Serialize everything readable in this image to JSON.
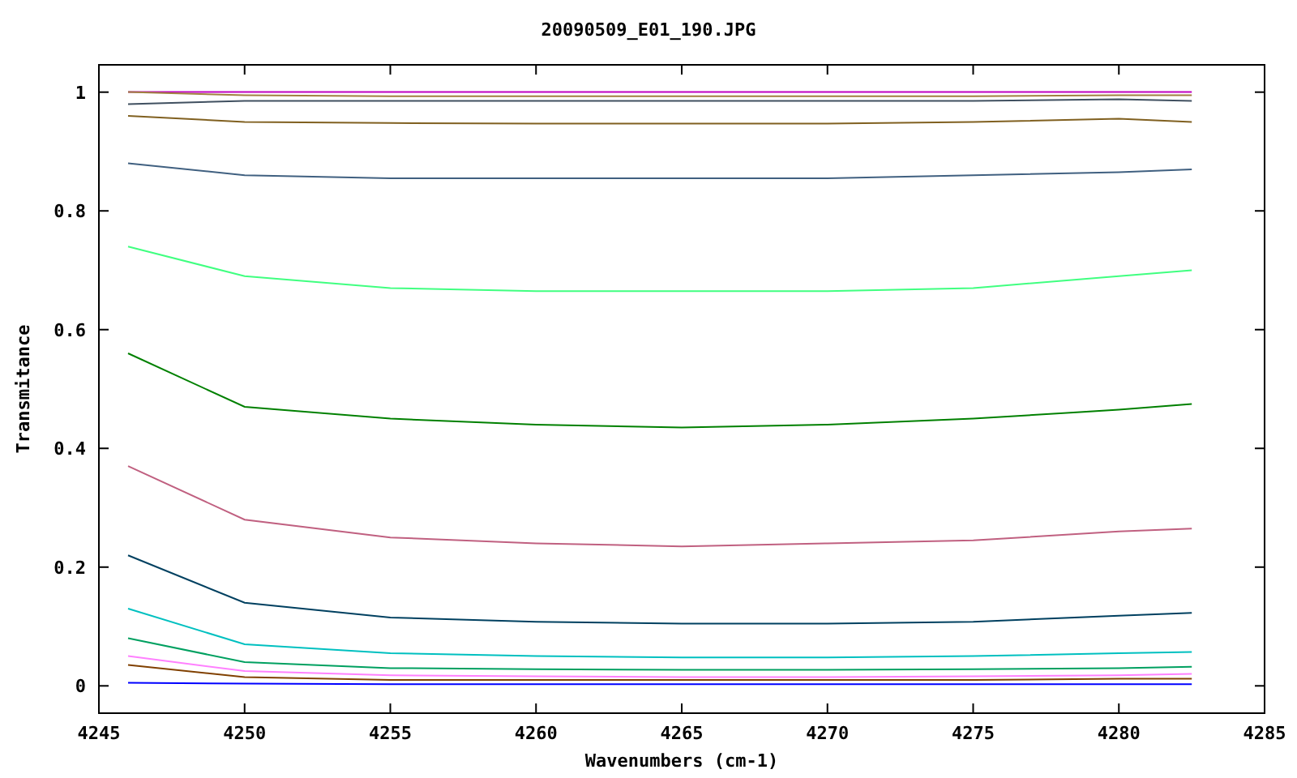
{
  "chart": {
    "chart_data": {
      "type": "line",
      "title": "20090509_E01_190.JPG",
      "xlabel": "Wavenumbers (cm-1)",
      "ylabel": "Transmitance",
      "x": [
        4246,
        4250,
        4255,
        4260,
        4265,
        4270,
        4275,
        4280,
        4282.5
      ],
      "xlim": [
        4245,
        4285
      ],
      "ylim": [
        -0.046,
        1.046
      ],
      "xticks": [
        4245,
        4250,
        4255,
        4260,
        4265,
        4270,
        4275,
        4280,
        4285
      ],
      "yticks": [
        0,
        0.2,
        0.4,
        0.6,
        0.8,
        1
      ],
      "series": [
        {
          "color": "#c000c0",
          "values": [
            1,
            1,
            1,
            1,
            1,
            1,
            1,
            1,
            1
          ]
        },
        {
          "color": "#a08040",
          "values": [
            1.0,
            0.995,
            0.993,
            0.993,
            0.993,
            0.993,
            0.993,
            0.995,
            0.995
          ]
        },
        {
          "color": "#405060",
          "values": [
            0.98,
            0.985,
            0.985,
            0.985,
            0.985,
            0.985,
            0.985,
            0.988,
            0.985
          ]
        },
        {
          "color": "#806020",
          "values": [
            0.96,
            0.95,
            0.948,
            0.947,
            0.947,
            0.947,
            0.95,
            0.955,
            0.95
          ]
        },
        {
          "color": "#406080",
          "values": [
            0.88,
            0.86,
            0.855,
            0.855,
            0.855,
            0.855,
            0.86,
            0.865,
            0.87
          ]
        },
        {
          "color": "#40ff80",
          "values": [
            0.74,
            0.69,
            0.67,
            0.665,
            0.665,
            0.665,
            0.67,
            0.69,
            0.7
          ]
        },
        {
          "color": "#008000",
          "values": [
            0.56,
            0.47,
            0.45,
            0.44,
            0.435,
            0.44,
            0.45,
            0.465,
            0.475
          ]
        },
        {
          "color": "#c06080",
          "values": [
            0.37,
            0.28,
            0.25,
            0.24,
            0.235,
            0.24,
            0.245,
            0.26,
            0.265
          ]
        },
        {
          "color": "#004060",
          "values": [
            0.22,
            0.14,
            0.115,
            0.108,
            0.105,
            0.105,
            0.108,
            0.118,
            0.123
          ]
        },
        {
          "color": "#00c0c0",
          "values": [
            0.13,
            0.07,
            0.055,
            0.05,
            0.048,
            0.048,
            0.05,
            0.055,
            0.057
          ]
        },
        {
          "color": "#00a060",
          "values": [
            0.08,
            0.04,
            0.03,
            0.028,
            0.027,
            0.027,
            0.028,
            0.03,
            0.032
          ]
        },
        {
          "color": "#ff80ff",
          "values": [
            0.05,
            0.025,
            0.018,
            0.016,
            0.015,
            0.015,
            0.016,
            0.018,
            0.02
          ]
        },
        {
          "color": "#804000",
          "values": [
            0.035,
            0.015,
            0.01,
            0.01,
            0.01,
            0.01,
            0.01,
            0.012,
            0.012
          ]
        },
        {
          "color": "#0000ff",
          "values": [
            0.005,
            0.004,
            0.003,
            0.003,
            0.003,
            0.003,
            0.003,
            0.003,
            0.003
          ]
        }
      ]
    }
  }
}
